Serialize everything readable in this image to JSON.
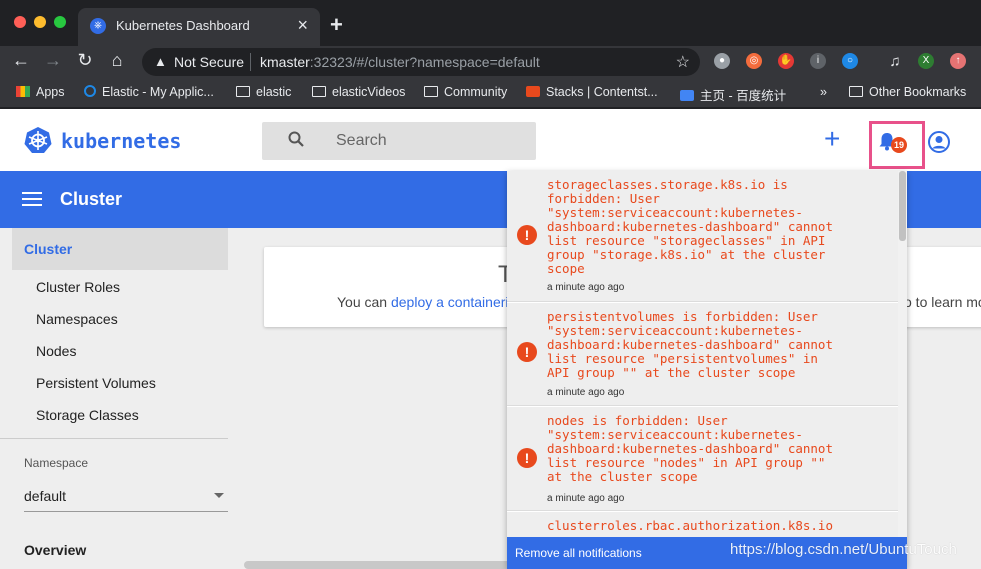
{
  "browser": {
    "tab_title": "Kubernetes Dashboard",
    "tab_close": "×",
    "new_tab": "+",
    "security_label": "Not Secure",
    "url_host": "kmaster",
    "url_rest": ":32323/#/cluster?namespace=default",
    "extension_badge": "X",
    "bookmarks": [
      {
        "label": "Apps"
      },
      {
        "label": "Elastic - My Applic..."
      },
      {
        "label": "elastic"
      },
      {
        "label": "elasticVideos"
      },
      {
        "label": "Community"
      },
      {
        "label": "Stacks | Contentst..."
      },
      {
        "label": "主页 - 百度统计"
      },
      {
        "label": "»"
      },
      {
        "label": "Other Bookmarks"
      }
    ]
  },
  "app": {
    "brand": "kubernetes",
    "search_placeholder": "Search",
    "add_label": "+",
    "notification_count": "19",
    "section_title": "Cluster"
  },
  "sidebar": {
    "active": "Cluster",
    "items": [
      {
        "label": "Cluster Roles"
      },
      {
        "label": "Namespaces"
      },
      {
        "label": "Nodes"
      },
      {
        "label": "Persistent Volumes"
      },
      {
        "label": "Storage Classes"
      }
    ],
    "namespace_label": "Namespace",
    "namespace_value": "default",
    "overview": "Overview"
  },
  "card": {
    "title_fragment": "T",
    "text_prefix": "You can ",
    "link_text": "deploy a containeri",
    "text_suffix": "o to learn more"
  },
  "notifications": {
    "items": [
      {
        "message": "storageclasses.storage.k8s.io is\nforbidden: User\n\"system:serviceaccount:kubernetes-\ndashboard:kubernetes-dashboard\" cannot\nlist resource \"storageclasses\" in API\ngroup \"storage.k8s.io\" at the cluster\nscope",
        "time": "a minute ago ago"
      },
      {
        "message": "persistentvolumes is forbidden: User\n\"system:serviceaccount:kubernetes-\ndashboard:kubernetes-dashboard\" cannot\nlist resource \"persistentvolumes\" in\nAPI group \"\" at the cluster scope",
        "time": "a minute ago ago"
      },
      {
        "message": "nodes is forbidden: User\n\"system:serviceaccount:kubernetes-\ndashboard:kubernetes-dashboard\" cannot\nlist resource \"nodes\" in API group \"\"\nat the cluster scope",
        "time": "a minute ago ago"
      },
      {
        "message": "clusterroles.rbac.authorization.k8s.io",
        "time": ""
      }
    ],
    "icon_glyph": "!",
    "remove_all": "Remove all notifications"
  },
  "watermark": "https://blog.csdn.net/UbuntuTouch",
  "colors": {
    "k8s_blue": "#326ce5",
    "error_red": "#e8491d",
    "highlight_pink": "#e8518a"
  }
}
